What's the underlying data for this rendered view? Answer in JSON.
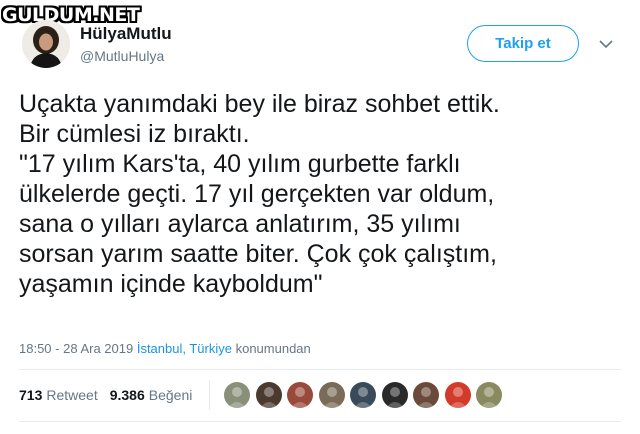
{
  "watermark": {
    "text": "GULDUM.NET"
  },
  "user": {
    "display_name": "HülyaMutlu",
    "handle": "@MutluHulya",
    "avatar_icon": "profile-photo"
  },
  "follow_button": {
    "label": "Takip et"
  },
  "menu_icon": "chevron-down-icon",
  "tweet": {
    "text": "Uçakta yanımdaki bey ile biraz  sohbet ettik.\nBir cümlesi iz bıraktı.\n\"17 yılım Kars'ta, 40 yılım gurbette farklı\nülkelerde geçti. 17 yıl gerçekten var oldum,\nsana  o yılları aylarca anlatırım, 35 yılımı\nsorsan yarım saatte biter. Çok çok çalıştım,\nyaşamın içinde kayboldum\""
  },
  "meta": {
    "time": "18:50 - 28 Ara 2019",
    "location": "İstanbul, Türkiye",
    "suffix": "konumundan"
  },
  "stats": {
    "retweets": "713",
    "retweet_label": "Retweet",
    "likes": "9.386",
    "like_label": "Beğeni"
  },
  "likers": [
    {
      "icon": "liker-avatar-1",
      "color": "#8a8f7a"
    },
    {
      "icon": "liker-avatar-2",
      "color": "#4a3a30"
    },
    {
      "icon": "liker-avatar-3",
      "color": "#9a4a3a"
    },
    {
      "icon": "liker-avatar-4",
      "color": "#7a6a58"
    },
    {
      "icon": "liker-avatar-5",
      "color": "#3a4a5a"
    },
    {
      "icon": "liker-avatar-6",
      "color": "#2a2a2a"
    },
    {
      "icon": "liker-avatar-7",
      "color": "#6a4a3a"
    },
    {
      "icon": "liker-avatar-8",
      "color": "#d23a2a"
    },
    {
      "icon": "liker-avatar-9",
      "color": "#8a8a60"
    }
  ],
  "colors": {
    "accent": "#1da1f2",
    "link": "#1b95e0",
    "secondary_text": "#657786",
    "primary_text": "#14171a"
  }
}
